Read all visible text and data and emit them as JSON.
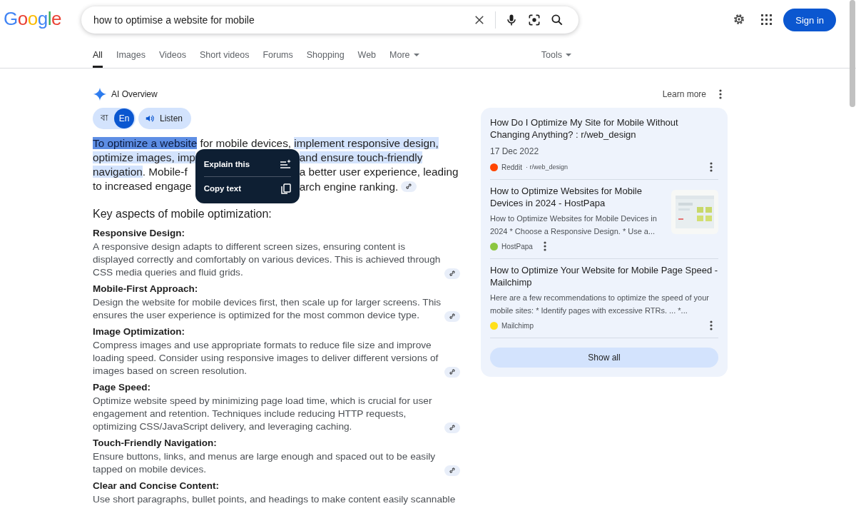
{
  "header": {
    "logo": "Google",
    "search": {
      "value": "how to optimise a website for mobile"
    },
    "sign_in": "Sign in"
  },
  "tabs": [
    {
      "label": "All",
      "selected": true,
      "dropdown": false
    },
    {
      "label": "Images",
      "selected": false,
      "dropdown": false
    },
    {
      "label": "Videos",
      "selected": false,
      "dropdown": false
    },
    {
      "label": "Short videos",
      "selected": false,
      "dropdown": false
    },
    {
      "label": "Forums",
      "selected": false,
      "dropdown": false
    },
    {
      "label": "Shopping",
      "selected": false,
      "dropdown": false
    },
    {
      "label": "Web",
      "selected": false,
      "dropdown": false
    },
    {
      "label": "More",
      "selected": false,
      "dropdown": true
    }
  ],
  "tools": "Tools",
  "ai_overview": {
    "title": "AI Overview",
    "learn_more": "Learn more",
    "languages": [
      {
        "label": "বা",
        "selected": false
      },
      {
        "label": "En",
        "selected": true
      }
    ],
    "listen": "Listen",
    "intro": {
      "first_line": [
        {
          "text": "To optimize a website",
          "selected": true,
          "highlighted": false
        },
        {
          "text": " for mobile devices, ",
          "selected": false,
          "highlighted": false
        },
        {
          "text": "implement responsive design,",
          "selected": false,
          "highlighted": true
        }
      ],
      "lines": [
        {
          "left": [
            {
              "text": "optimize images, imp",
              "selected": false,
              "highlighted": true
            }
          ],
          "right": [
            {
              "text": "and ensure touch-friendly",
              "selected": false,
              "highlighted": true
            }
          ],
          "citation": false
        },
        {
          "left": [
            {
              "text": "navigation",
              "selected": false,
              "highlighted": true
            },
            {
              "text": ". Mobile-f",
              "selected": false,
              "highlighted": false
            }
          ],
          "right": [
            {
              "text": "a better user experience, leading",
              "selected": false,
              "highlighted": false
            }
          ],
          "citation": false
        },
        {
          "left": [
            {
              "text": "to increased engage",
              "selected": false,
              "highlighted": false
            }
          ],
          "right": [
            {
              "text": "arch engine ranking.",
              "selected": false,
              "highlighted": false
            }
          ],
          "citation": true
        }
      ]
    },
    "popup": [
      "Explain this",
      "Copy text"
    ],
    "heading": "Key aspects of mobile optimization:",
    "sections": [
      {
        "heading": "Responsive Design:",
        "text": "A responsive design adapts to different screen sizes, ensuring content is displayed correctly and comfortably on various devices. This is achieved through CSS media queries and fluid grids.",
        "citation": true
      },
      {
        "heading": "Mobile-First Approach:",
        "text": "Design the website for mobile devices first, then scale up for larger screens. This ensures the user experience is optimized for the most common device type.",
        "citation": true
      },
      {
        "heading": "Image Optimization:",
        "text": "Compress images and use appropriate formats to reduce file size and improve loading speed. Consider using responsive images to deliver different versions of images based on screen resolution.",
        "citation": true
      },
      {
        "heading": "Page Speed:",
        "text": "Optimize website speed by minimizing page load time, which is crucial for user engagement and retention. Techniques include reducing HTTP requests, optimizing CSS/JavaScript delivery, and leveraging caching.",
        "citation": true
      },
      {
        "heading": "Touch-Friendly Navigation:",
        "text": "Ensure buttons, links, and menus are large enough and spaced out to be easily tapped on mobile devices.",
        "citation": true
      },
      {
        "heading": "Clear and Concise Content:",
        "text": "Use short paragraphs, bullet points, and headings to make content easily scannable",
        "citation": false
      }
    ]
  },
  "sources": {
    "items": [
      {
        "title": "How Do I Optimize My Site for Mobile Without Changing Anything? : r/web_design",
        "date": "17 Dec 2022",
        "source": "Reddit",
        "path": "· r/web_design",
        "color": "#ff4500"
      },
      {
        "title": "How to Optimize Websites for Mobile Devices in 2024 - HostPapa",
        "snippet": "How to Optimize Websites for Mobile Devices in 2024 * Choose a Responsive Design. * Use a...",
        "source": "HostPapa",
        "color": "#8cc63f",
        "kind": "picture"
      },
      {
        "title": "How to Optimize Your Website for Mobile Page Speed - Mailchimp",
        "snippet": "Here are a few recommendations to optimize the speed of your mobile sites: * Identify pages with excessive RTRs. ... *...",
        "source": "Mailchimp",
        "color": "#ffe01b"
      }
    ],
    "show_all": "Show all"
  }
}
